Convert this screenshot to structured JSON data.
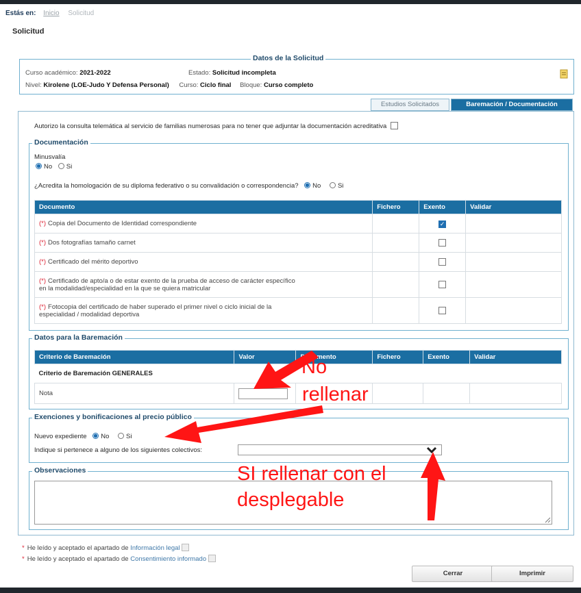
{
  "breadcrumb": {
    "label": "Estás en:",
    "home": "Inicio",
    "current": "Solicitud"
  },
  "page_title": "Solicitud",
  "datos": {
    "legend": "Datos de la Solicitud",
    "curso_label": "Curso académico:",
    "curso_value": "2021-2022",
    "estado_label": "Estado:",
    "estado_value": "Solicitud incompleta",
    "nivel_label": "Nivel:",
    "nivel_value": "Kirolene (LOE-Judo Y Defensa Personal)",
    "curso2_label": "Curso:",
    "curso2_value": "Ciclo final",
    "bloque_label": "Bloque:",
    "bloque_value": "Curso completo"
  },
  "tabs": [
    "Estudios Solicitados",
    "Baremación / Documentación"
  ],
  "autorizo": "Autorizo la consulta telemática al servicio de familias numerosas para no tener que adjuntar la documentación acreditativa",
  "documentacion": {
    "legend": "Documentación",
    "minusvalia_label": "Minusvalía",
    "no": "No",
    "si": "Si",
    "homologacion_q": "¿Acredita la homologación de su diploma federativo o su convalidación o correspondencia?",
    "headers": [
      "Documento",
      "Fichero",
      "Exento",
      "Validar"
    ],
    "rows": [
      {
        "req": "(*)",
        "line1": "Copia del Documento de Identidad correspondiente",
        "line2": "",
        "exento": true
      },
      {
        "req": "(*)",
        "line1": "Dos fotografías tamaño carnet",
        "line2": "",
        "exento": false
      },
      {
        "req": "(*)",
        "line1": "Certificado del mérito deportivo",
        "line2": "",
        "exento": false
      },
      {
        "req": "(*)",
        "line1": "Certificado de apto/a o de estar exento de la prueba de acceso de carácter específico",
        "line2": "en la modalidad/especialidad en la que se quiera matricular",
        "exento": false
      },
      {
        "req": "(*)",
        "line1": "Fotocopia del certificado de haber superado el primer nivel o ciclo inicial de la",
        "line2": "especialidad / modalidad deportiva",
        "exento": false
      }
    ]
  },
  "baremacion": {
    "legend": "Datos para la Baremación",
    "headers": [
      "Criterio de Baremación",
      "Valor",
      "Documento",
      "Fichero",
      "Exento",
      "Validar"
    ],
    "group": "Criterio de Baremación GENERALES",
    "nota": "Nota"
  },
  "exenciones": {
    "legend": "Exenciones y bonificaciones al precio público",
    "nuevo_label": "Nuevo expediente",
    "no": "No",
    "si": "Si",
    "colectivos_label": "Indique si pertenece a alguno de los siguientes colectivos:"
  },
  "observaciones": {
    "legend": "Observaciones"
  },
  "legal": {
    "prefix": "He leído y aceptado el apartado de",
    "link1": "Información legal",
    "link2": "Consentimiento informado"
  },
  "buttons": {
    "cerrar": "Cerrar",
    "imprimir": "Imprimir"
  },
  "annotations": {
    "no_line1": "No",
    "no_line2": "rellenar",
    "si_line1": "SI rellenar con el",
    "si_line2": "desplegable",
    "color": "#ff1515"
  }
}
